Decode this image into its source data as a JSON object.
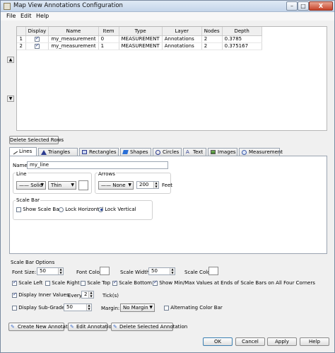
{
  "window": {
    "title": "Map View Annotations Configuration",
    "minimize": "–",
    "maximize": "□",
    "close": "X"
  },
  "menu": [
    "File",
    "Edit",
    "Help"
  ],
  "table": {
    "columns": [
      "",
      "Display",
      "Name",
      "Item",
      "Type",
      "Layer",
      "Nodes",
      "Depth"
    ],
    "rows": [
      {
        "index": "1",
        "display": true,
        "name": "my_measurement",
        "item": "0",
        "type": "MEASUREMENT",
        "layer": "Annotations",
        "nodes": "2",
        "depth": "0.3785"
      },
      {
        "index": "2",
        "display": true,
        "name": "my_measurement",
        "item": "1",
        "type": "MEASUREMENT",
        "layer": "Annotations",
        "nodes": "2",
        "depth": "0.375167"
      }
    ]
  },
  "delete_rows_label": "Delete Selected Rows",
  "tabs": [
    "Lines",
    "Triangles",
    "Rectangles",
    "Shapes",
    "Circles",
    "Text",
    "Images",
    "Measurement"
  ],
  "lines": {
    "name_label": "Name:",
    "name_value": "my_line",
    "line_group": "Line",
    "line_style": "Solid",
    "line_width": "Thin",
    "arrows_group": "Arrows",
    "arrow_style": "None",
    "arrow_size": "200",
    "arrow_unit": "Feet",
    "scale_bar_group": "Scale Bar",
    "show_scale_bar": "Show Scale Bar",
    "lock_horizontal": "Lock Horizontal",
    "lock_vertical": "Lock Vertical"
  },
  "scale_bar_options": {
    "title": "Scale Bar Options",
    "font_size_label": "Font Size:",
    "font_size": "50",
    "font_color_label": "Font Color:",
    "scale_width_label": "Scale Width:",
    "scale_width": "50",
    "scale_color_label": "Scale Color:",
    "scale_left": "Scale Left",
    "scale_right": "Scale Right",
    "scale_top": "Scale Top",
    "scale_bottom": "Scale Bottom",
    "show_min_max": "Show Min/Max Values at Ends of Scale Bars on All Four Corners",
    "display_inner": "Display Inner Values",
    "every_label": "Every",
    "every_value": "2",
    "ticks_label": "Tick(s)",
    "display_subgrades": "Display Sub-Grades",
    "subgrades_value": "50",
    "margin_label": "Margin:",
    "margin_value": "No Margin",
    "alternating": "Alternating Color Bar"
  },
  "annotation_buttons": [
    "Create New Annotation",
    "Edit Annotation",
    "Delete Selected Annotation"
  ],
  "dialog_buttons": {
    "ok": "OK",
    "cancel": "Cancel",
    "apply": "Apply",
    "help": "Help"
  }
}
